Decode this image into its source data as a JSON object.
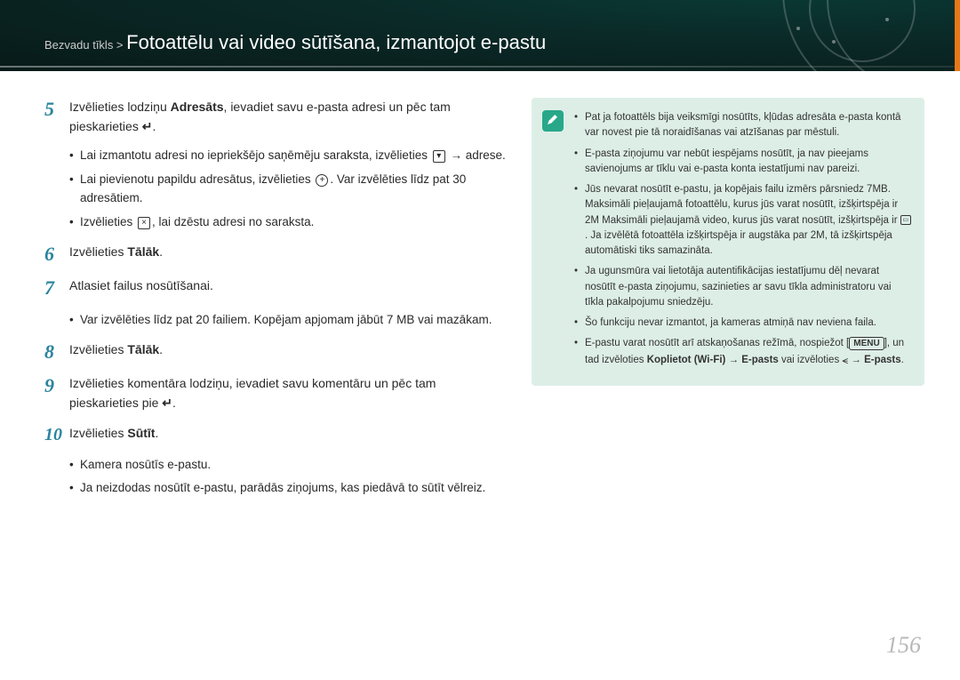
{
  "breadcrumb_prefix": "Bezvadu tīkls > ",
  "title": "Fotoattēlu vai video sūtīšana, izmantojot e-pastu",
  "page_number": "156",
  "steps": {
    "s5": {
      "num": "5",
      "text_a": "Izvēlieties lodziņu ",
      "bold": "Adresāts",
      "text_b": ", ievadiet savu e-pasta adresi un pēc tam pieskarieties ",
      "icon_ret": "↵",
      "text_c": "."
    },
    "s5_sub1a": "Lai izmantotu adresi no iepriekšējo saņēmēju saraksta, izvēlieties ",
    "s5_sub1_ic": "▾",
    "s5_sub1b": " → adrese.",
    "s5_sub2a": "Lai pievienotu papildu adresātus, izvēlieties ",
    "s5_sub2_ic": "+",
    "s5_sub2b": ". Var izvēlēties līdz pat 30 adresātiem.",
    "s5_sub3a": "Izvēlieties ",
    "s5_sub3_ic": "×",
    "s5_sub3b": ", lai dzēstu adresi no saraksta.",
    "s6": {
      "num": "6",
      "text_a": "Izvēlieties ",
      "bold": "Tālāk",
      "text_b": "."
    },
    "s7": {
      "num": "7",
      "text": "Atlasiet failus nosūtīšanai."
    },
    "s7_sub": "Var izvēlēties līdz pat 20 failiem. Kopējam apjomam jābūt 7 MB vai mazākam.",
    "s8": {
      "num": "8",
      "text_a": "Izvēlieties ",
      "bold": "Tālāk",
      "text_b": "."
    },
    "s9": {
      "num": "9",
      "text_a": "Izvēlieties komentāra lodziņu, ievadiet savu komentāru un pēc tam pieskarieties pie ",
      "icon_ret": "↵",
      "text_b": "."
    },
    "s10": {
      "num": "10",
      "text_a": "Izvēlieties ",
      "bold": "Sūtīt",
      "text_b": "."
    },
    "s10_sub1": "Kamera nosūtīs e-pastu.",
    "s10_sub2": "Ja neizdodas nosūtīt e-pastu, parādās ziņojums, kas piedāvā to sūtīt vēlreiz."
  },
  "tips": {
    "t1": "Pat ja fotoattēls bija veiksmīgi nosūtīts, kļūdas adresāta e-pasta kontā var novest pie tā noraidīšanas vai atzīšanas par mēstuli.",
    "t2": "E-pasta ziņojumu var nebūt iespējams nosūtīt, ja nav pieejams savienojums ar tīklu vai e-pasta konta iestatījumi nav pareizi.",
    "t3a": "Jūs nevarat nosūtīt e-pastu, ja kopējais failu izmērs pārsniedz 7MB. Maksimāli pieļaujamā fotoattēlu, kurus jūs varat nosūtīt, izšķirtspēja ir 2M Maksimāli pieļaujamā video, kurus jūs varat nosūtīt, izšķirtspēja ir ",
    "t3_ic": "▭",
    "t3b": ". Ja izvēlētā fotoattēla izšķirtspēja ir augstāka par 2M, tā izšķirtspēja automātiski tiks samazināta.",
    "t4": "Ja ugunsmūra vai lietotāja autentifikācijas iestatījumu dēļ nevarat nosūtīt e-pasta ziņojumu, sazinieties ar savu tīkla administratoru vai tīkla pakalpojumu sniedzēju.",
    "t5": "Šo funkciju nevar izmantot, ja kameras atmiņā nav neviena faila.",
    "t6a": "E-pastu varat nosūtīt arī atskaņošanas režīmā, nospiežot [",
    "t6_menu": "MENU",
    "t6b": "], un tad izvēloties ",
    "t6_bold1": "Koplietot (Wi-Fi)",
    "t6_arrow": " → ",
    "t6_bold2": "E-pasts",
    "t6c": " vai izvēloties ",
    "t6d": " → ",
    "t6_bold3": "E-pasts",
    "t6e": "."
  }
}
